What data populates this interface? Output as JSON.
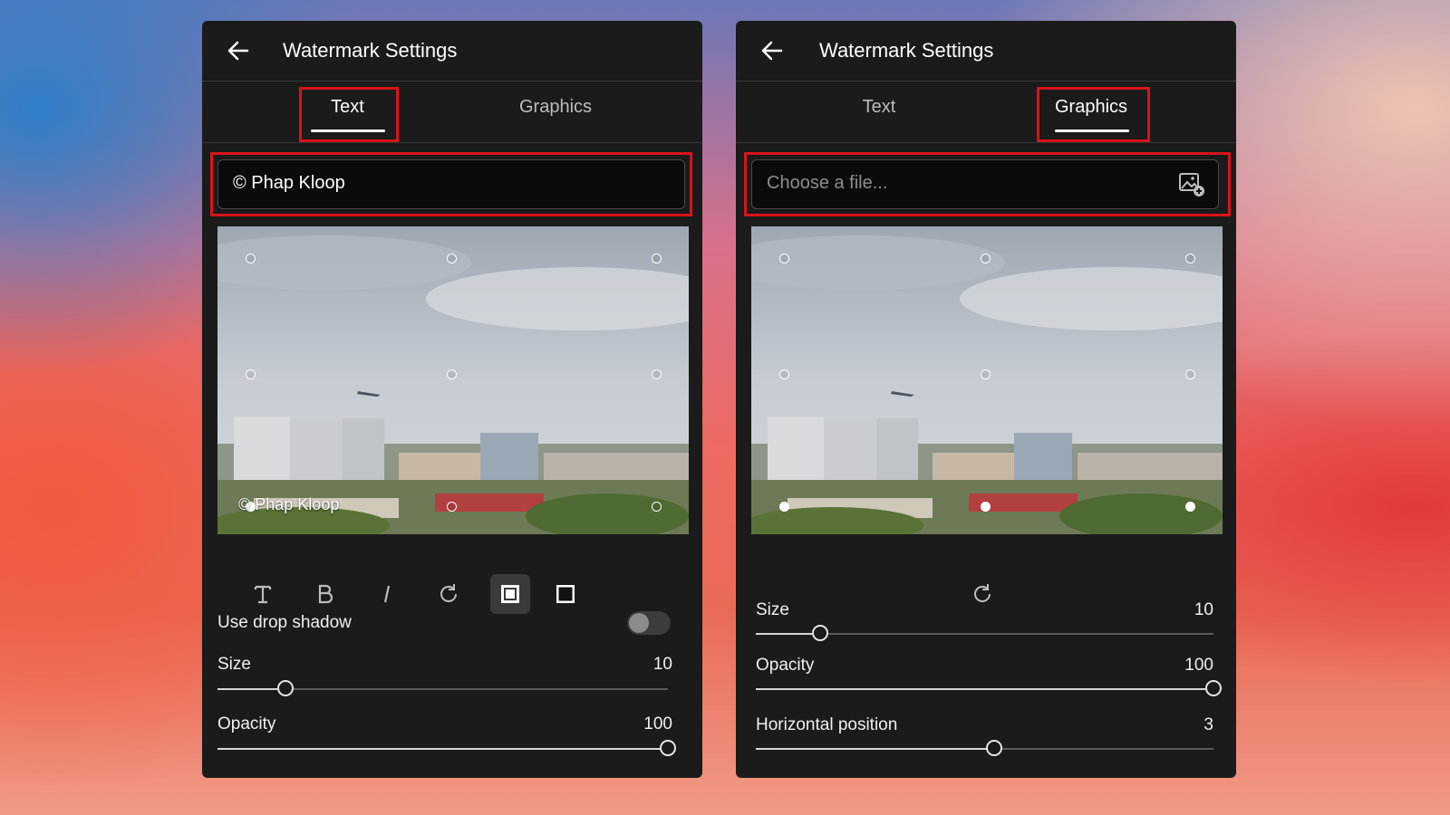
{
  "left_panel": {
    "title": "Watermark Settings",
    "tabs": [
      "Text",
      "Graphics"
    ],
    "active_tab": "Text",
    "text_value": "© Phap Kloop",
    "preview_watermark": "© Phap Kloop",
    "drop_shadow_label": "Use drop shadow",
    "drop_shadow_on": false,
    "sliders": [
      {
        "label": "Size",
        "value": "10",
        "fraction": 0.15
      },
      {
        "label": "Opacity",
        "value": "100",
        "fraction": 1.0
      }
    ]
  },
  "right_panel": {
    "title": "Watermark Settings",
    "tabs": [
      "Text",
      "Graphics"
    ],
    "active_tab": "Graphics",
    "file_placeholder": "Choose a file...",
    "sliders": [
      {
        "label": "Size",
        "value": "10",
        "fraction": 0.14
      },
      {
        "label": "Opacity",
        "value": "100",
        "fraction": 1.0
      },
      {
        "label": "Horizontal position",
        "value": "3",
        "fraction": 0.52
      }
    ]
  },
  "icons": [
    "arrow-left-icon",
    "text-type-icon",
    "bold-icon",
    "italic-icon",
    "rotate-icon",
    "shadow-box-icon",
    "outline-box-icon",
    "image-add-icon"
  ],
  "colors": {
    "highlight": "#d8141b",
    "panel": "#1b1b1b"
  }
}
